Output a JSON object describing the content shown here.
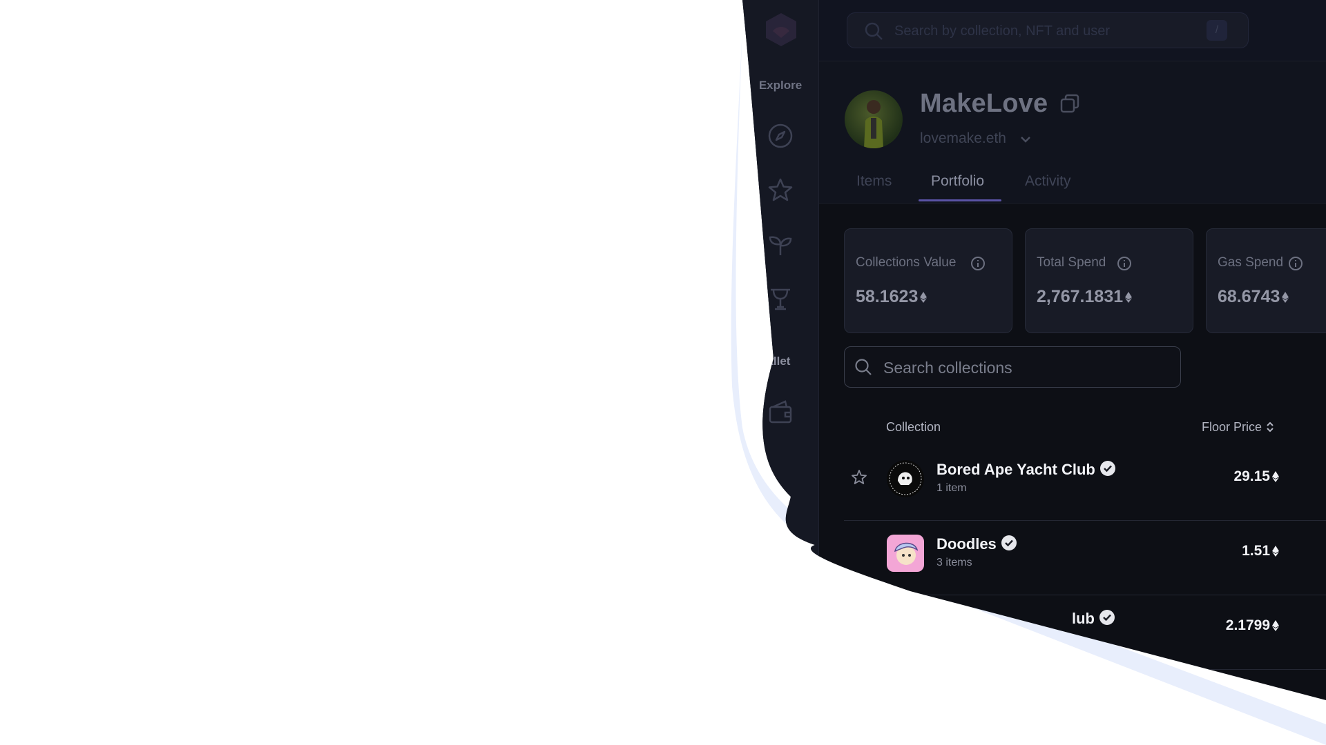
{
  "colors": {
    "accent": "#5a53a6",
    "background": "#0d0f15",
    "sidebar": "#151823"
  },
  "sidebar": {
    "logo": "app-logo-icon",
    "explore_label": "Explore",
    "wallet_label": "Wallet",
    "explore_icons": [
      "compass-icon",
      "star-icon",
      "sprout-icon",
      "trophy-icon"
    ],
    "wallet_icons": [
      "wallet-icon"
    ]
  },
  "topbar": {
    "search_placeholder": "Search by collection, NFT and user",
    "search_shortcut": "/"
  },
  "profile": {
    "name": "MakeLove",
    "ens": "lovemake.eth"
  },
  "tabs": [
    {
      "label": "Items",
      "active": false
    },
    {
      "label": "Portfolio",
      "active": true
    },
    {
      "label": "Activity",
      "active": false
    }
  ],
  "stats": [
    {
      "label": "Collections Value",
      "value": "58.1623"
    },
    {
      "label": "Total Spend",
      "value": "2,767.1831"
    },
    {
      "label": "Gas Spend",
      "value": "68.6743"
    }
  ],
  "collection_search": {
    "placeholder": "Search collections"
  },
  "table": {
    "headers": {
      "collection": "Collection",
      "floor_price": "Floor Price"
    },
    "rows": [
      {
        "name": "Bored Ape Yacht Club",
        "items": "1 item",
        "floor": "29.15",
        "verified": true
      },
      {
        "name": "Doodles",
        "items": "3 items",
        "floor": "1.51",
        "verified": true
      },
      {
        "name": "Mutant Ape Yacht Club",
        "name_visible": "lub",
        "items": "",
        "floor": "2.1799",
        "verified": true
      }
    ]
  }
}
